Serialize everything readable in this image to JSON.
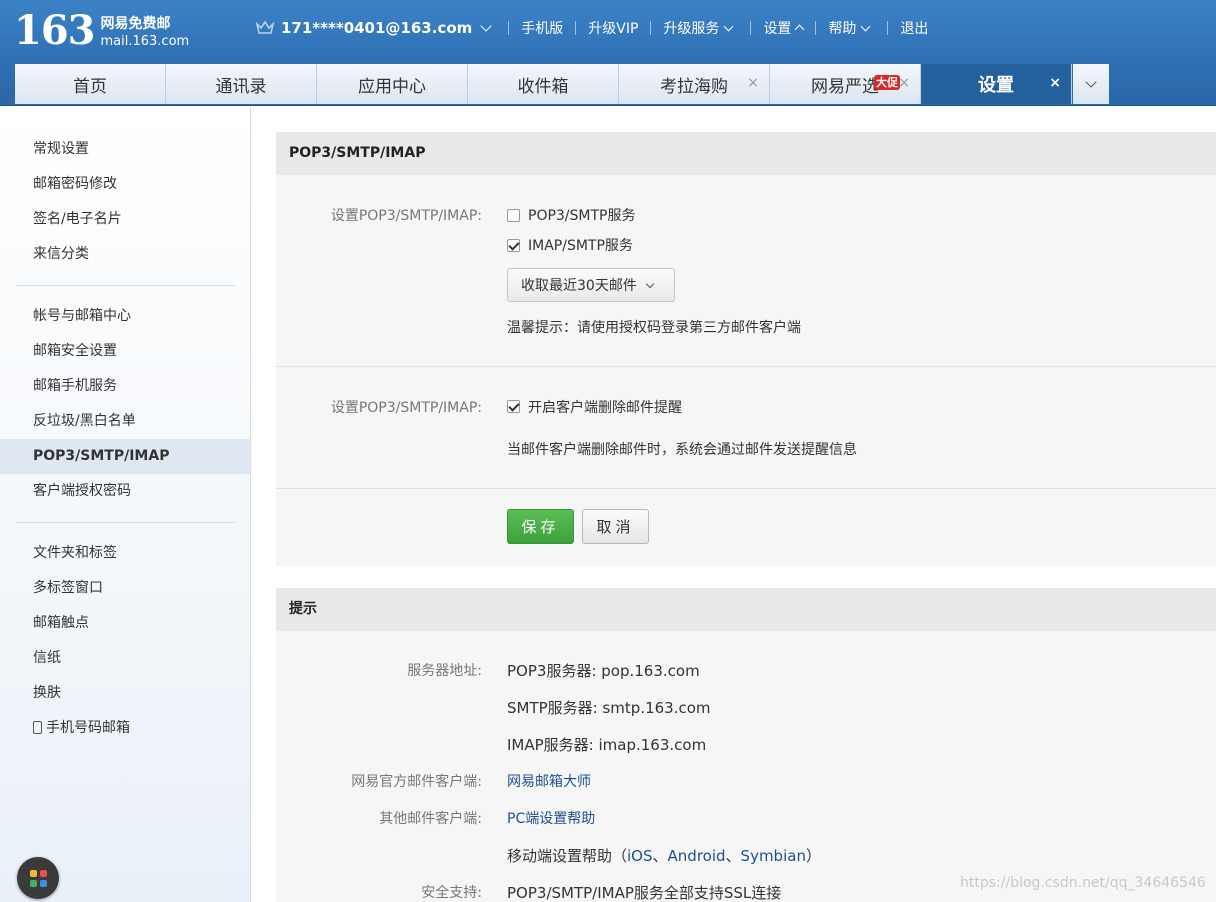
{
  "header": {
    "logo_num": "163",
    "logo_cn": "网易免费邮",
    "logo_en": "mail.163.com",
    "account": "171****0401@163.com",
    "links": [
      "手机版",
      "升级VIP",
      "升级服务",
      "设置",
      "帮助",
      "退出"
    ]
  },
  "tabs": [
    {
      "label": "首页"
    },
    {
      "label": "通讯录"
    },
    {
      "label": "应用中心"
    },
    {
      "label": "收件箱"
    },
    {
      "label": "考拉海购",
      "close": "×"
    },
    {
      "label": "网易严选",
      "close": "×",
      "badge": "大促"
    },
    {
      "label": "设置",
      "close": "×",
      "active": true
    }
  ],
  "sidebar": {
    "group1": [
      "常规设置",
      "邮箱密码修改",
      "签名/电子名片",
      "来信分类"
    ],
    "group2": [
      "帐号与邮箱中心",
      "邮箱安全设置",
      "邮箱手机服务",
      "反垃圾/黑白名单",
      "POP3/SMTP/IMAP",
      "客户端授权密码"
    ],
    "group3": [
      "文件夹和标签",
      "多标签窗口",
      "邮箱触点",
      "信纸",
      "换肤",
      "手机号码邮箱"
    ],
    "active": "POP3/SMTP/IMAP"
  },
  "settings": {
    "title": "POP3/SMTP/IMAP",
    "label1": "设置POP3/SMTP/IMAP:",
    "pop3_label": "POP3/SMTP服务",
    "pop3_checked": false,
    "imap_label": "IMAP/SMTP服务",
    "imap_checked": true,
    "select_value": "收取最近30天邮件",
    "tip": "温馨提示：请使用授权码登录第三方邮件客户端",
    "label2": "设置POP3/SMTP/IMAP:",
    "delete_alert_label": "开启客户端删除邮件提醒",
    "delete_alert_checked": true,
    "delete_alert_desc": "当邮件客户端删除邮件时，系统会通过邮件发送提醒信息",
    "save": "保存",
    "cancel": "取消"
  },
  "hints": {
    "title": "提示",
    "server_label": "服务器地址:",
    "pop3_server": "POP3服务器: pop.163.com",
    "smtp_server": "SMTP服务器: smtp.163.com",
    "imap_server": "IMAP服务器: imap.163.com",
    "official_label": "网易官方邮件客户端:",
    "official_link": "网易邮箱大师",
    "other_label": "其他邮件客户端:",
    "pc_help": "PC端设置帮助",
    "mobile_prefix": "移动端设置帮助（",
    "ios": "iOS",
    "dun1": "、",
    "android": "Android",
    "dun2": "、",
    "symbian": "Symbian",
    "mobile_suffix": "）",
    "security_label": "安全支持:",
    "security_value": "POP3/SMTP/IMAP服务全部支持SSL连接"
  },
  "watermark": "https://blog.csdn.net/qq_34646546"
}
